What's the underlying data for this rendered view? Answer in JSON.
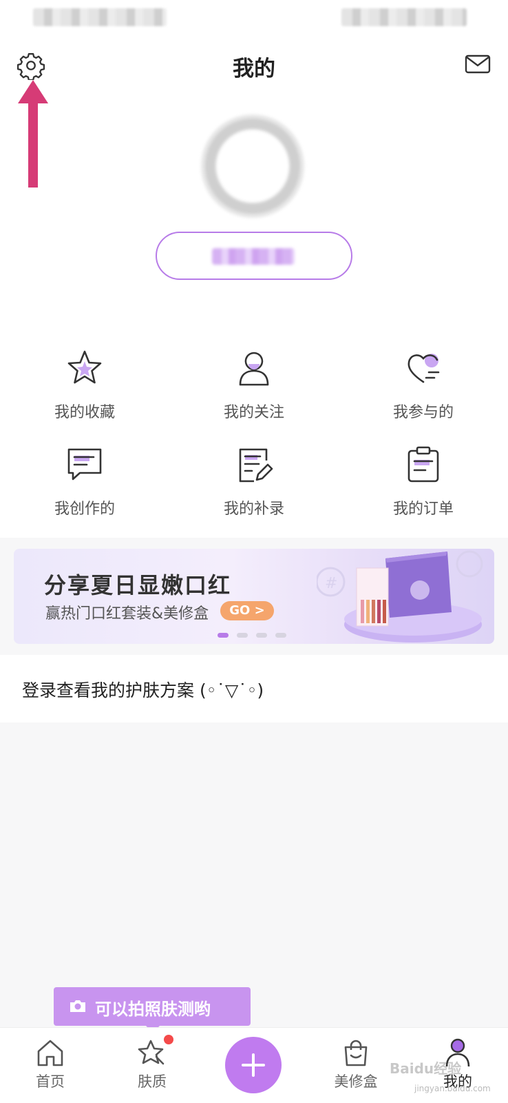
{
  "header": {
    "title": "我的"
  },
  "grid": {
    "items": [
      {
        "label": "我的收藏",
        "icon": "star-icon"
      },
      {
        "label": "我的关注",
        "icon": "person-icon"
      },
      {
        "label": "我参与的",
        "icon": "heart-icon"
      },
      {
        "label": "我创作的",
        "icon": "chat-icon"
      },
      {
        "label": "我的补录",
        "icon": "edit-note-icon"
      },
      {
        "label": "我的订单",
        "icon": "clipboard-icon"
      }
    ]
  },
  "banner": {
    "title": "分享夏日显嫩口红",
    "subtitle": "赢热门口红套装&美修盒",
    "cta": "GO >",
    "slides": 4,
    "active_slide": 1
  },
  "plan": {
    "text": "登录查看我的护肤方案 (◦˙▽˙◦)"
  },
  "tooltip": {
    "text": "可以拍照肤测哟"
  },
  "tabbar": {
    "tabs": [
      {
        "label": "首页",
        "icon": "home-icon"
      },
      {
        "label": "肤质",
        "icon": "skin-star-icon"
      },
      {
        "label": "",
        "icon": "plus-icon"
      },
      {
        "label": "美修盒",
        "icon": "bag-icon"
      },
      {
        "label": "我的",
        "icon": "profile-icon"
      }
    ],
    "active": "我的"
  },
  "watermark": {
    "text": "Baidu经验",
    "url": "jingyan.baidu.com"
  },
  "colors": {
    "accent": "#c07bef",
    "arrow": "#d63b76",
    "badge": "#f44a4a"
  }
}
